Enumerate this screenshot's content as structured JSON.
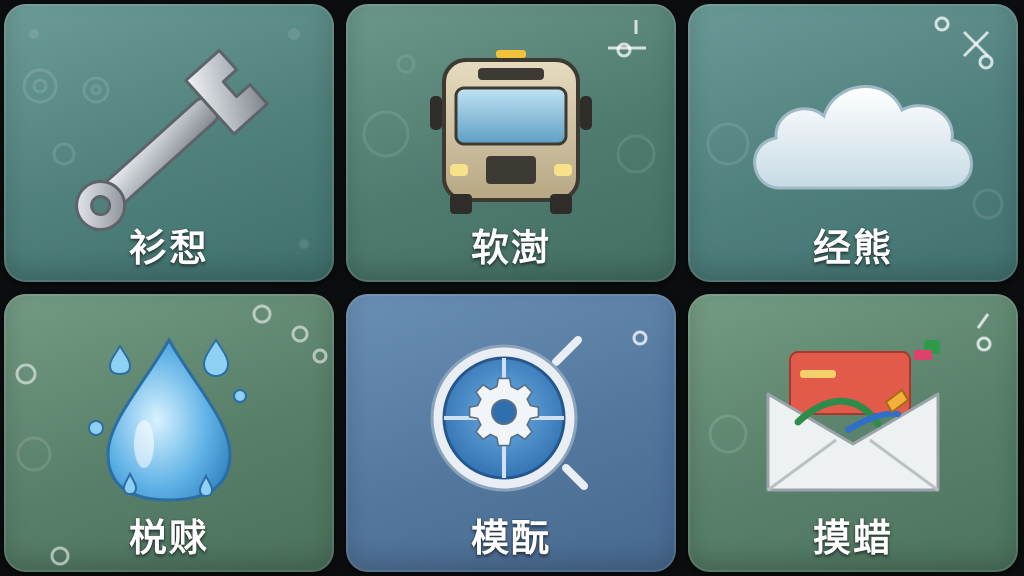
{
  "tiles": [
    {
      "label": "衫惒",
      "icon": "wrench-icon"
    },
    {
      "label": "软澍",
      "icon": "bus-icon"
    },
    {
      "label": "经熊",
      "icon": "cloud-icon"
    },
    {
      "label": "棁赇",
      "icon": "water-drop-icon"
    },
    {
      "label": "模酛",
      "icon": "gear-compass-icon"
    },
    {
      "label": "摸蜡",
      "icon": "mail-envelope-icon"
    }
  ],
  "colors": {
    "background": "#0b0d0e",
    "tile_teal": "#4f807b",
    "tile_green": "#587f69",
    "tile_blue": "#54779e",
    "label_text": "#ffffff"
  }
}
